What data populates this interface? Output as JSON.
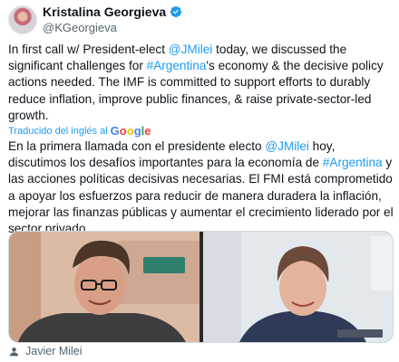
{
  "author": {
    "name": "Kristalina Georgieva",
    "handle": "@KGeorgieva",
    "avatar_icon": "profile-photo"
  },
  "tweet": {
    "en": {
      "t1": "In first call w/ President-elect ",
      "mention": "@JMilei",
      "t2": " today, we discussed the significant challenges for ",
      "hashtag": "#Argentina",
      "t3": "'s economy & the decisive policy actions needed. The IMF is committed to support efforts to durably reduce inflation, improve public finances, & raise private-sector-led growth."
    },
    "translated_label": "Traducido del inglés al",
    "translated_provider": "Google",
    "es": {
      "t1": "En la primera llamada con el presidente electo ",
      "mention": "@JMilei",
      "t2": " hoy, discutimos los desafíos importantes para la economía de ",
      "hashtag": "#Argentina",
      "t3": " y las acciones políticas decisivas necesarias. El FMI está comprometido a apoyar los esfuerzos para reducir de manera duradera la inflación, mejorar las finanzas públicas y aumentar el crecimiento liderado por el sector privado."
    }
  },
  "media": {
    "tagged_person": "Javier Milei",
    "tag_icon": "person-icon"
  },
  "colors": {
    "link": "#1d9bf0",
    "text": "#0f1419",
    "muted": "#536471",
    "verified": "#1d9bf0"
  }
}
